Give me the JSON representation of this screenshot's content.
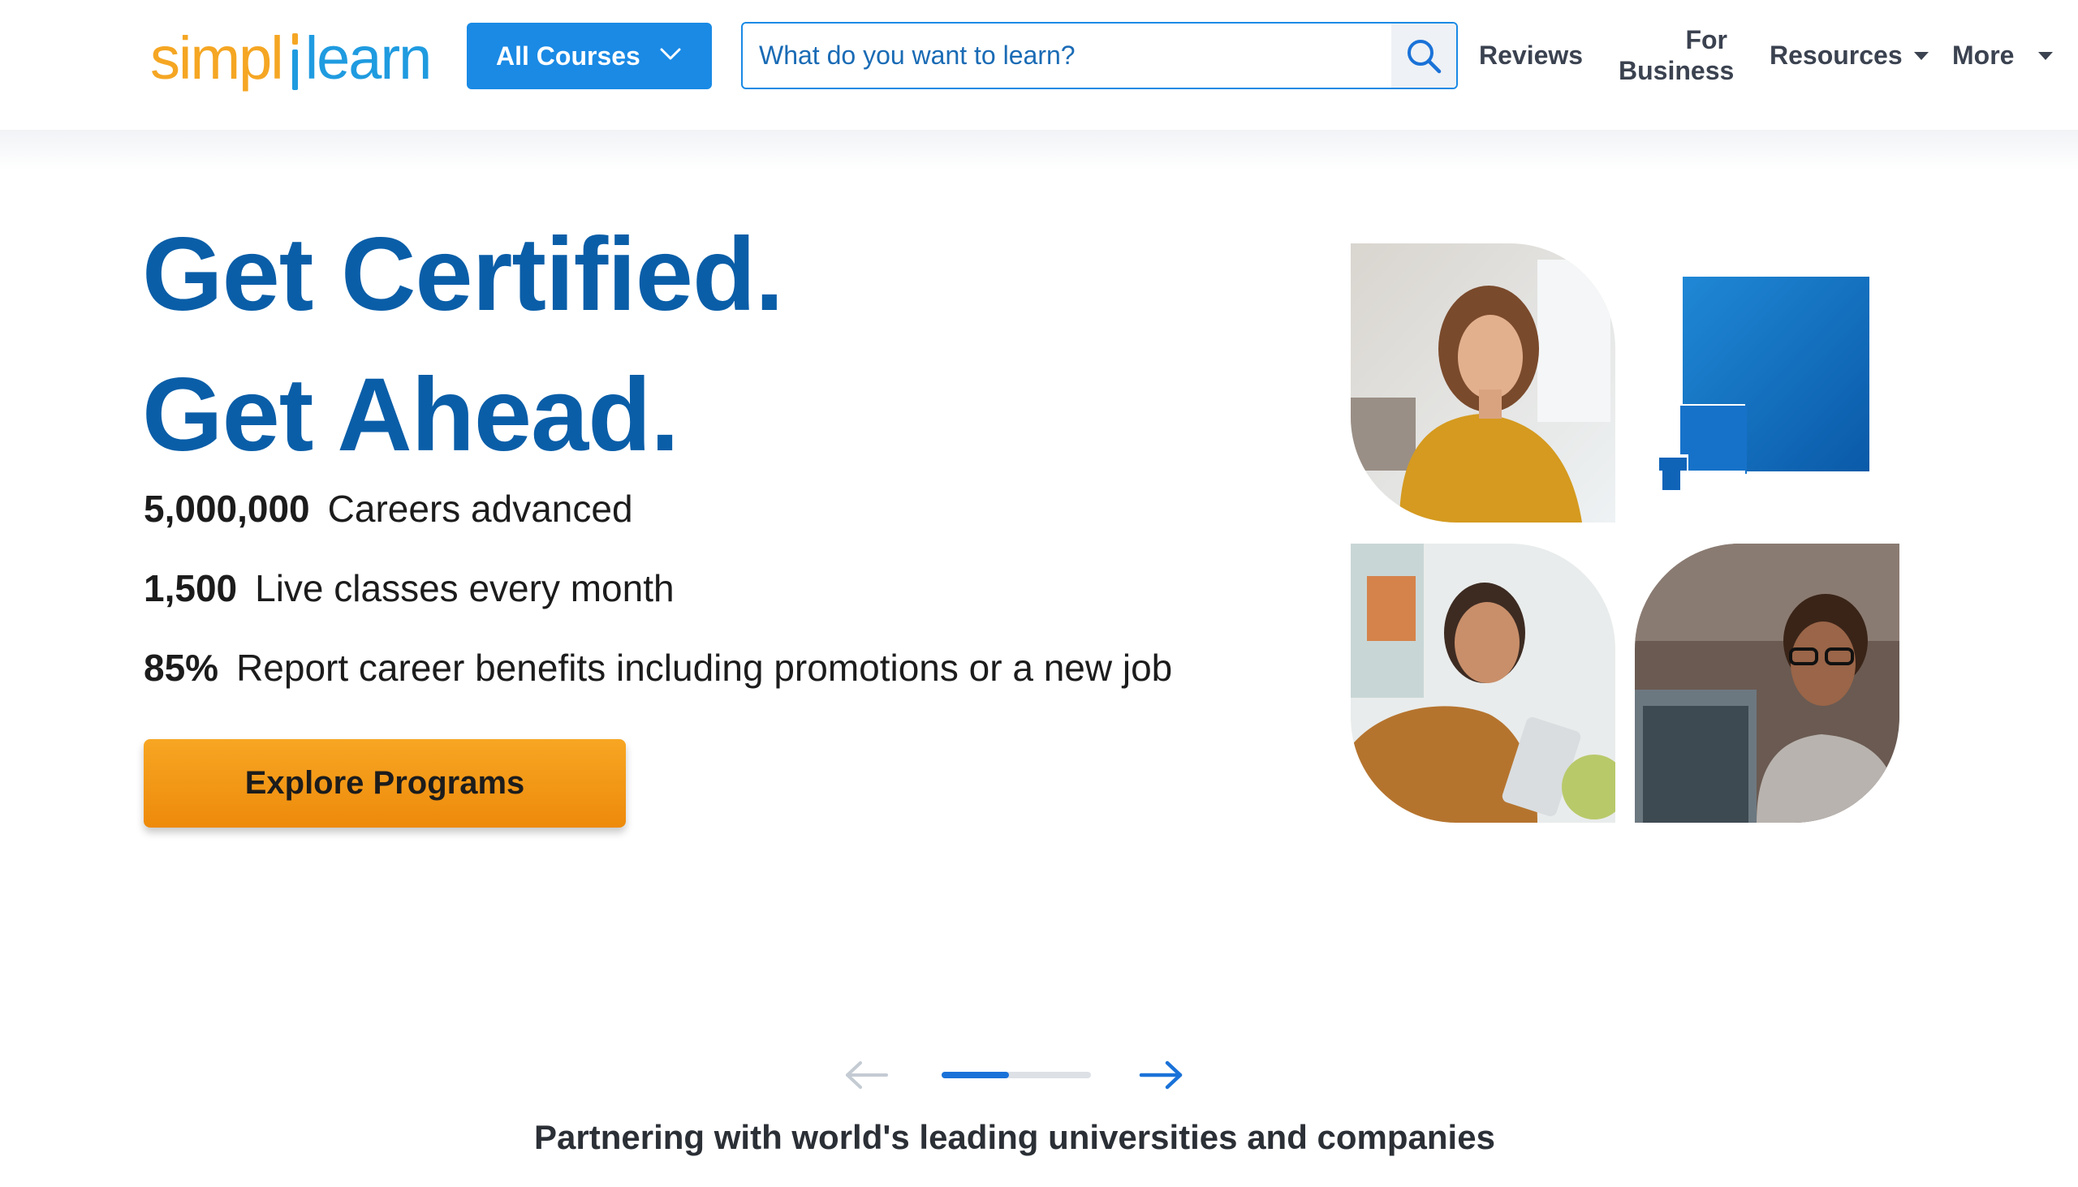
{
  "header": {
    "logo": {
      "part1": "simpl",
      "part2": "learn"
    },
    "all_courses_label": "All Courses",
    "search": {
      "placeholder": "What do you want to learn?",
      "value": ""
    },
    "nav": {
      "reviews": "Reviews",
      "for_business_line1": "For",
      "for_business_line2": "Business",
      "resources": "Resources",
      "more": "More"
    }
  },
  "hero": {
    "title_line1": "Get Certified.",
    "title_line2": "Get Ahead.",
    "stats": [
      {
        "value": "5,000,000",
        "label": "Careers advanced"
      },
      {
        "value": "1,500",
        "label": "Live classes every month"
      },
      {
        "value": "85%",
        "label": "Report career benefits including promotions or a new job"
      }
    ],
    "cta_label": "Explore Programs"
  },
  "carousel": {
    "progress_fraction": 0.45
  },
  "partner_text": "Partnering with world's leading universities and companies",
  "colors": {
    "brand_blue": "#0a5ea8",
    "primary_button": "#1a8ae5",
    "cta_orange": "#f29a18",
    "logo_orange": "#f5a623",
    "logo_blue": "#1f9be0"
  }
}
